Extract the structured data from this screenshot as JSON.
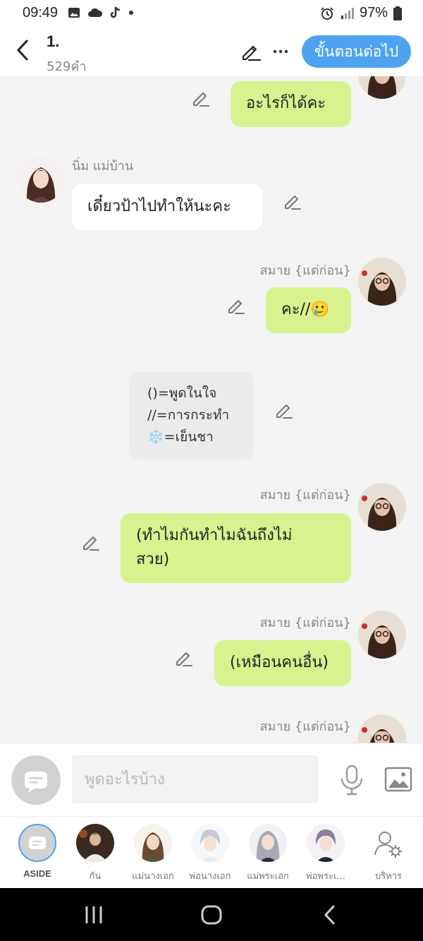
{
  "status_bar": {
    "time": "09:49",
    "battery": "97%",
    "icons": [
      "image-icon",
      "cloud-icon",
      "tiktok-icon",
      "dot-icon"
    ],
    "right_icons": [
      "alarm-icon",
      "signal-icon",
      "battery-icon"
    ]
  },
  "header": {
    "title": "1.",
    "word_count": "529คำ",
    "next_label": "ขั้นตอนต่อไป"
  },
  "messages": [
    {
      "side": "right",
      "text": "อะไรก็ได้คะ"
    },
    {
      "side": "left",
      "speaker": "นิ่ม แม่บ้าน",
      "text": "เดี๋ยวป้าไปทำให้นะคะ"
    },
    {
      "side": "right",
      "speaker": "สมาย {แต่ก่อน}",
      "text": "คะ//🥲"
    },
    {
      "side": "center",
      "lines": [
        "()=พูดในใจ",
        "//=การกระทำ",
        "❄️=เย็นชา"
      ]
    },
    {
      "side": "right",
      "speaker": "สมาย {แต่ก่อน}",
      "lines": [
        "(ทำไมกันทำไมฉันถึงไม่",
        "สวย)"
      ]
    },
    {
      "side": "right",
      "speaker": "สมาย {แต่ก่อน}",
      "text": "(เหมือนคนอื่น)"
    },
    {
      "side": "right",
      "speaker": "สมาย {แต่ก่อน}",
      "text": ""
    }
  ],
  "input": {
    "placeholder": "พูดอะไรบ้าง"
  },
  "characters": [
    {
      "label": "ASIDE"
    },
    {
      "label": "กัน"
    },
    {
      "label": "แม่นางเอก"
    },
    {
      "label": "พ่อนางเอก"
    },
    {
      "label": "แม่พระเอก"
    },
    {
      "label": "พ่อพระเ..."
    },
    {
      "label": "บริหาร"
    }
  ],
  "colors": {
    "accent": "#4da3ef",
    "bubble_green": "#d7f28f",
    "aside_bubble": "#ebebeb"
  }
}
